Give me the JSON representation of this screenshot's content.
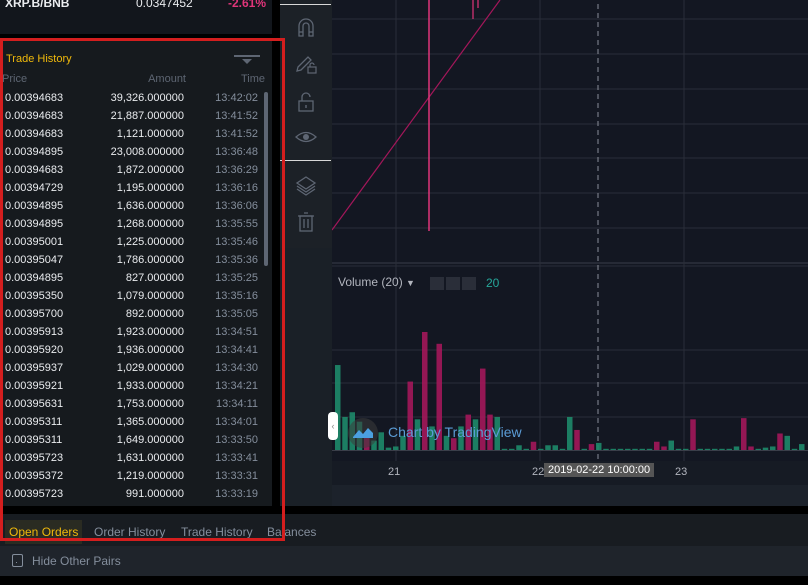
{
  "market": {
    "pair": "XRP.B/BNB",
    "price": "0.0347452",
    "change": "-2.61%"
  },
  "trade_history": {
    "title": "Trade History",
    "headers": {
      "price": "Price",
      "amount": "Amount",
      "time": "Time"
    },
    "rows": [
      {
        "price": "0.00394683",
        "amount": "39,326.000000",
        "time": "13:42:02"
      },
      {
        "price": "0.00394683",
        "amount": "21,887.000000",
        "time": "13:41:52"
      },
      {
        "price": "0.00394683",
        "amount": "1,121.000000",
        "time": "13:41:52"
      },
      {
        "price": "0.00394895",
        "amount": "23,008.000000",
        "time": "13:36:48"
      },
      {
        "price": "0.00394683",
        "amount": "1,872.000000",
        "time": "13:36:29"
      },
      {
        "price": "0.00394729",
        "amount": "1,195.000000",
        "time": "13:36:16"
      },
      {
        "price": "0.00394895",
        "amount": "1,636.000000",
        "time": "13:36:06"
      },
      {
        "price": "0.00394895",
        "amount": "1,268.000000",
        "time": "13:35:55"
      },
      {
        "price": "0.00395001",
        "amount": "1,225.000000",
        "time": "13:35:46"
      },
      {
        "price": "0.00395047",
        "amount": "1,786.000000",
        "time": "13:35:36"
      },
      {
        "price": "0.00394895",
        "amount": "827.000000",
        "time": "13:35:25"
      },
      {
        "price": "0.00395350",
        "amount": "1,079.000000",
        "time": "13:35:16"
      },
      {
        "price": "0.00395700",
        "amount": "892.000000",
        "time": "13:35:05"
      },
      {
        "price": "0.00395913",
        "amount": "1,923.000000",
        "time": "13:34:51"
      },
      {
        "price": "0.00395920",
        "amount": "1,936.000000",
        "time": "13:34:41"
      },
      {
        "price": "0.00395937",
        "amount": "1,029.000000",
        "time": "13:34:30"
      },
      {
        "price": "0.00395921",
        "amount": "1,933.000000",
        "time": "13:34:21"
      },
      {
        "price": "0.00395631",
        "amount": "1,753.000000",
        "time": "13:34:11"
      },
      {
        "price": "0.00395311",
        "amount": "1,365.000000",
        "time": "13:34:01"
      },
      {
        "price": "0.00395311",
        "amount": "1,649.000000",
        "time": "13:33:50"
      },
      {
        "price": "0.00395723",
        "amount": "1,631.000000",
        "time": "13:33:41"
      },
      {
        "price": "0.00395372",
        "amount": "1,219.000000",
        "time": "13:33:31"
      },
      {
        "price": "0.00395723",
        "amount": "991.000000",
        "time": "13:33:19"
      }
    ]
  },
  "toolbar": {
    "icons": [
      "magnet-icon",
      "pencil-lock-icon",
      "unlock-icon",
      "eye-icon",
      "layers-icon",
      "trash-icon"
    ]
  },
  "chart": {
    "volume_label": "Volume (20)",
    "volume_value": "20",
    "watermark": "Chart by TradingView",
    "time_ticks": [
      "21",
      "22",
      "23"
    ],
    "crosshair_time": "2019-02-22 10:00:00",
    "colors": {
      "up": "#1e8a6a",
      "down": "#a3175a",
      "volume_value": "#26a69a"
    },
    "volume_bars": [
      {
        "d": "up",
        "v": 0.72
      },
      {
        "d": "up",
        "v": 0.28
      },
      {
        "d": "up",
        "v": 0.32
      },
      {
        "d": "up",
        "v": 0.24
      },
      {
        "d": "down",
        "v": 0.14
      },
      {
        "d": "up",
        "v": 0.08
      },
      {
        "d": "up",
        "v": 0.15
      },
      {
        "d": "up",
        "v": 0.02
      },
      {
        "d": "up",
        "v": 0.03
      },
      {
        "d": "up",
        "v": 0.12
      },
      {
        "d": "down",
        "v": 0.58
      },
      {
        "d": "up",
        "v": 0.26
      },
      {
        "d": "down",
        "v": 1.0
      },
      {
        "d": "up",
        "v": 0.2
      },
      {
        "d": "down",
        "v": 0.9
      },
      {
        "d": "up",
        "v": 0.12
      },
      {
        "d": "down",
        "v": 0.1
      },
      {
        "d": "up",
        "v": 0.2
      },
      {
        "d": "down",
        "v": 0.3
      },
      {
        "d": "up",
        "v": 0.26
      },
      {
        "d": "down",
        "v": 0.69
      },
      {
        "d": "down",
        "v": 0.3
      },
      {
        "d": "up",
        "v": 0.28
      },
      {
        "d": "up",
        "v": 0.01
      },
      {
        "d": "up",
        "v": 0.01
      },
      {
        "d": "up",
        "v": 0.04
      },
      {
        "d": "up",
        "v": 0.01
      },
      {
        "d": "down",
        "v": 0.07
      },
      {
        "d": "up",
        "v": 0.01
      },
      {
        "d": "up",
        "v": 0.04
      },
      {
        "d": "up",
        "v": 0.04
      },
      {
        "d": "up",
        "v": 0.01
      },
      {
        "d": "up",
        "v": 0.28
      },
      {
        "d": "down",
        "v": 0.17
      },
      {
        "d": "up",
        "v": 0.01
      },
      {
        "d": "down",
        "v": 0.05
      },
      {
        "d": "up",
        "v": 0.06
      },
      {
        "d": "up",
        "v": 0.01
      },
      {
        "d": "up",
        "v": 0.01
      },
      {
        "d": "up",
        "v": 0.01
      },
      {
        "d": "up",
        "v": 0.01
      },
      {
        "d": "up",
        "v": 0.01
      },
      {
        "d": "up",
        "v": 0.01
      },
      {
        "d": "up",
        "v": 0.01
      },
      {
        "d": "down",
        "v": 0.07
      },
      {
        "d": "down",
        "v": 0.03
      },
      {
        "d": "up",
        "v": 0.08
      },
      {
        "d": "up",
        "v": 0.01
      },
      {
        "d": "up",
        "v": 0.01
      },
      {
        "d": "down",
        "v": 0.26
      },
      {
        "d": "up",
        "v": 0.01
      },
      {
        "d": "up",
        "v": 0.01
      },
      {
        "d": "up",
        "v": 0.01
      },
      {
        "d": "up",
        "v": 0.01
      },
      {
        "d": "up",
        "v": 0.01
      },
      {
        "d": "up",
        "v": 0.03
      },
      {
        "d": "down",
        "v": 0.27
      },
      {
        "d": "down",
        "v": 0.03
      },
      {
        "d": "up",
        "v": 0.01
      },
      {
        "d": "up",
        "v": 0.02
      },
      {
        "d": "up",
        "v": 0.03
      },
      {
        "d": "down",
        "v": 0.14
      },
      {
        "d": "up",
        "v": 0.12
      },
      {
        "d": "up",
        "v": 0.01
      },
      {
        "d": "up",
        "v": 0.05
      }
    ]
  },
  "tabs": [
    {
      "label": "Open Orders",
      "active": true
    },
    {
      "label": "Order History",
      "active": false
    },
    {
      "label": "Trade History",
      "active": false
    },
    {
      "label": "Balances",
      "active": false
    }
  ],
  "filter": {
    "hide_other_pairs_label": "Hide Other Pairs",
    "checked": false
  }
}
